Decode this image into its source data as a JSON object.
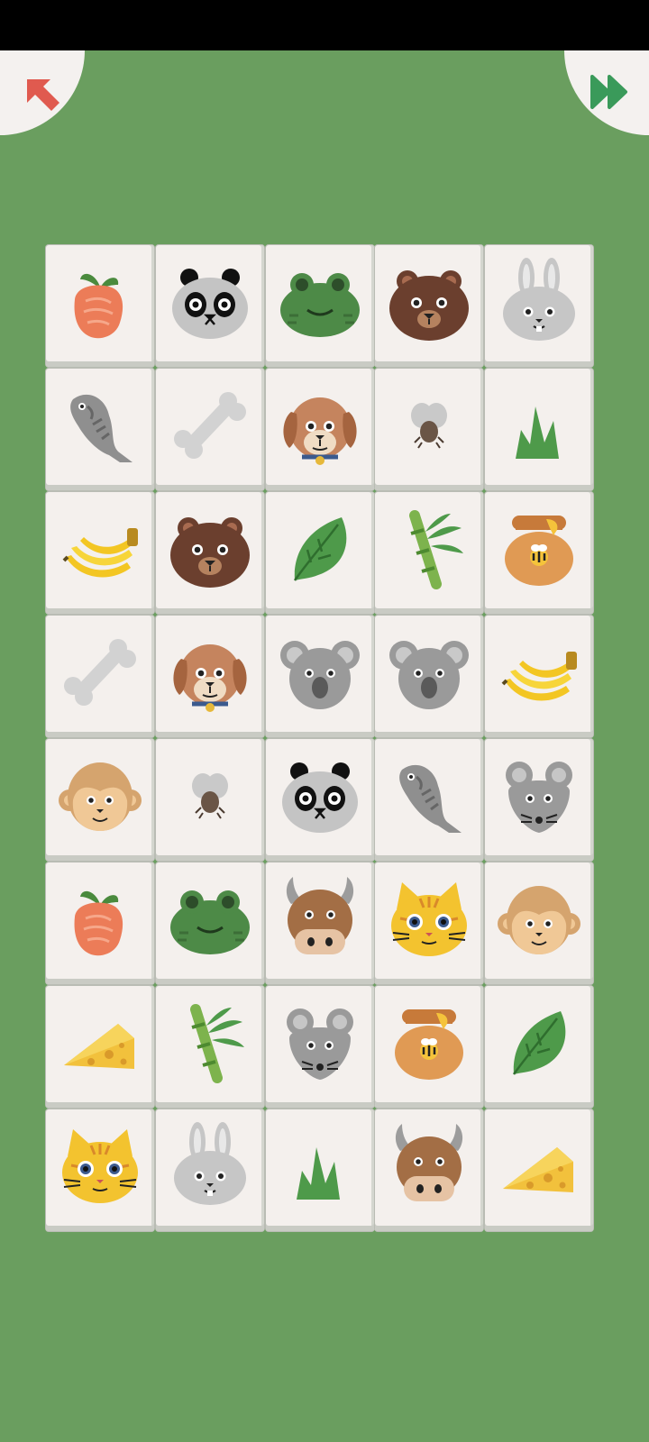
{
  "colors": {
    "background": "#6a9e5f",
    "tile": "#f4f0ed",
    "back_arrow": "#e05a4f",
    "skip_arrow": "#3a9a5a"
  },
  "toolbar": {
    "back_icon": "arrow-up-left-icon",
    "skip_icon": "fast-forward-icon"
  },
  "board": {
    "columns": 5,
    "rows": [
      [
        "carrot",
        "panda",
        "frog",
        "bear",
        "rabbit"
      ],
      [
        "fish",
        "bone",
        "dog",
        "fly",
        "grass"
      ],
      [
        "banana",
        "bear",
        "leaf",
        "bamboo",
        "honey"
      ],
      [
        "bone",
        "dog",
        "koala",
        "koala",
        "banana"
      ],
      [
        "monkey",
        "fly",
        "panda",
        "fish",
        "mouse"
      ],
      [
        "carrot",
        "frog",
        "ox",
        "cat",
        "monkey"
      ],
      [
        "cheese",
        "bamboo",
        "mouse",
        "honey",
        "leaf"
      ],
      [
        "cat",
        "rabbit",
        "grass",
        "ox",
        "cheese"
      ]
    ]
  }
}
